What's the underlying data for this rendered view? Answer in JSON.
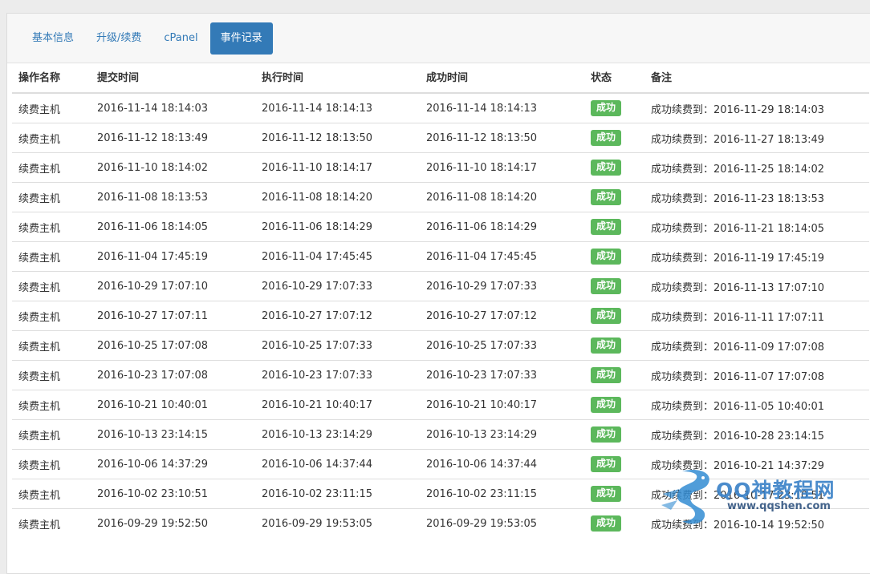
{
  "tabs": [
    {
      "label": "基本信息",
      "active": false
    },
    {
      "label": "升级/续费",
      "active": false
    },
    {
      "label": "cPanel",
      "active": false
    },
    {
      "label": "事件记录",
      "active": true
    }
  ],
  "table": {
    "headers": [
      "操作名称",
      "提交时间",
      "执行时间",
      "成功时间",
      "状态",
      "备注"
    ],
    "rows": [
      [
        "续费主机",
        "2016-11-14 18:14:03",
        "2016-11-14 18:14:13",
        "2016-11-14 18:14:13",
        "成功",
        "成功续费到：2016-11-29 18:14:03"
      ],
      [
        "续费主机",
        "2016-11-12 18:13:49",
        "2016-11-12 18:13:50",
        "2016-11-12 18:13:50",
        "成功",
        "成功续费到：2016-11-27 18:13:49"
      ],
      [
        "续费主机",
        "2016-11-10 18:14:02",
        "2016-11-10 18:14:17",
        "2016-11-10 18:14:17",
        "成功",
        "成功续费到：2016-11-25 18:14:02"
      ],
      [
        "续费主机",
        "2016-11-08 18:13:53",
        "2016-11-08 18:14:20",
        "2016-11-08 18:14:20",
        "成功",
        "成功续费到：2016-11-23 18:13:53"
      ],
      [
        "续费主机",
        "2016-11-06 18:14:05",
        "2016-11-06 18:14:29",
        "2016-11-06 18:14:29",
        "成功",
        "成功续费到：2016-11-21 18:14:05"
      ],
      [
        "续费主机",
        "2016-11-04 17:45:19",
        "2016-11-04 17:45:45",
        "2016-11-04 17:45:45",
        "成功",
        "成功续费到：2016-11-19 17:45:19"
      ],
      [
        "续费主机",
        "2016-10-29 17:07:10",
        "2016-10-29 17:07:33",
        "2016-10-29 17:07:33",
        "成功",
        "成功续费到：2016-11-13 17:07:10"
      ],
      [
        "续费主机",
        "2016-10-27 17:07:11",
        "2016-10-27 17:07:12",
        "2016-10-27 17:07:12",
        "成功",
        "成功续费到：2016-11-11 17:07:11"
      ],
      [
        "续费主机",
        "2016-10-25 17:07:08",
        "2016-10-25 17:07:33",
        "2016-10-25 17:07:33",
        "成功",
        "成功续费到：2016-11-09 17:07:08"
      ],
      [
        "续费主机",
        "2016-10-23 17:07:08",
        "2016-10-23 17:07:33",
        "2016-10-23 17:07:33",
        "成功",
        "成功续费到：2016-11-07 17:07:08"
      ],
      [
        "续费主机",
        "2016-10-21 10:40:01",
        "2016-10-21 10:40:17",
        "2016-10-21 10:40:17",
        "成功",
        "成功续费到：2016-11-05 10:40:01"
      ],
      [
        "续费主机",
        "2016-10-13 23:14:15",
        "2016-10-13 23:14:29",
        "2016-10-13 23:14:29",
        "成功",
        "成功续费到：2016-10-28 23:14:15"
      ],
      [
        "续费主机",
        "2016-10-06 14:37:29",
        "2016-10-06 14:37:44",
        "2016-10-06 14:37:44",
        "成功",
        "成功续费到：2016-10-21 14:37:29"
      ],
      [
        "续费主机",
        "2016-10-02 23:10:51",
        "2016-10-02 23:11:15",
        "2016-10-02 23:11:15",
        "成功",
        "成功续费到：2016-10-17 23:10:51"
      ],
      [
        "续费主机",
        "2016-09-29 19:52:50",
        "2016-09-29 19:53:05",
        "2016-09-29 19:53:05",
        "成功",
        "成功续费到：2016-10-14 19:52:50"
      ]
    ]
  },
  "watermark": {
    "text": "QQ神教程网",
    "url": "www.qqshen.com"
  },
  "colors": {
    "accent": "#337ab7",
    "success": "#5cb85c"
  }
}
